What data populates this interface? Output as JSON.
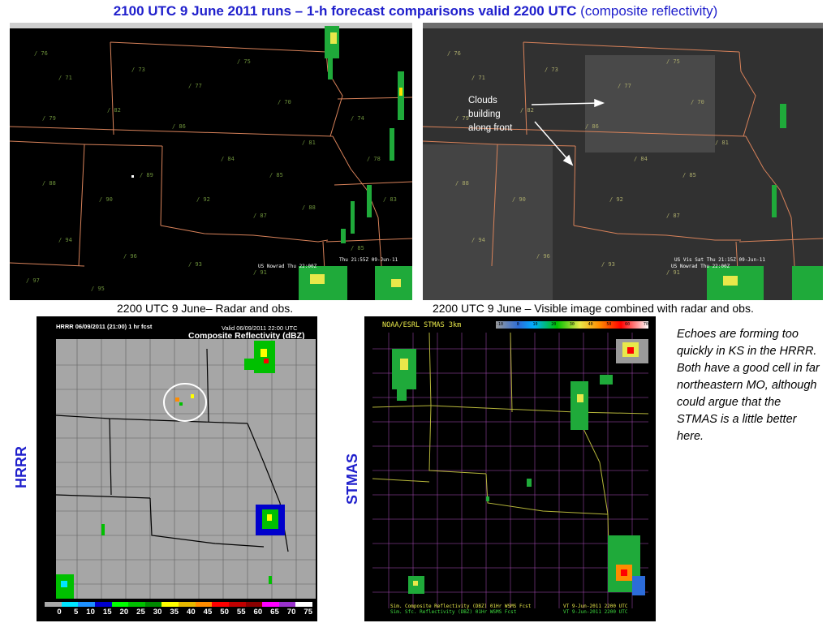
{
  "title": {
    "main": "2100 UTC 9 June 2011 runs – 1-h forecast comparisons valid 2200 UTC",
    "sub": "(composite reflectivity)"
  },
  "panels": {
    "radar_obs": {
      "caption": "2200 UTC 9 June– Radar and obs.",
      "footer": [
        "US Nowrad  Thu 22:00Z",
        "Thu 21:55Z 09-Jun-11"
      ]
    },
    "visible_obs": {
      "caption": "2200 UTC 9 June – Visible image combined with radar and obs.",
      "annotation": [
        "Clouds",
        "building",
        "along front"
      ],
      "footer": [
        "US Nowrad  Thu 22:00Z",
        "US Vis Sat  Thu 21:15Z 09-Jun-11"
      ]
    },
    "hrrr": {
      "side_label": "HRRR",
      "header_left": "HRRR 06/09/2011 (21:00) 1 hr fcst",
      "header_right": "Valid 06/09/2011 22:00 UTC",
      "product": "Composite Reflectivity (dBZ)",
      "scale": [
        "0",
        "5",
        "10",
        "15",
        "20",
        "25",
        "30",
        "35",
        "40",
        "45",
        "50",
        "55",
        "60",
        "65",
        "70",
        "75"
      ],
      "scale_colors": [
        "#a9a9a9",
        "#00e5ff",
        "#1e90ff",
        "#0000cc",
        "#00ff00",
        "#00c000",
        "#008a00",
        "#ffff00",
        "#e6b800",
        "#ff8c00",
        "#ff0000",
        "#c00000",
        "#8b0000",
        "#ff00ff",
        "#9932cc",
        "#ffffff"
      ]
    },
    "stmas": {
      "side_label": "STMAS",
      "header": "NOAA/ESRL STMAS 3km",
      "scale": [
        "-10",
        "0",
        "10",
        "20",
        "30",
        "40",
        "50",
        "60",
        "70"
      ],
      "footer_left": [
        "Sim. Composite Reflectivity (DBZ)  01Hr WSMS Fcst",
        "Sim. Sfc. Reflectivity (DBZ)  01Hr WSMS Fcst"
      ],
      "footer_right": [
        "VT 9-Jun-2011 2200 UTC",
        "VT 9-Jun-2011 2200 UTC"
      ]
    }
  },
  "note": "Echoes are forming too quickly in KS in the HRRR. Both have a good cell in far northeastern MO, although could argue that the STMAS is a little better here."
}
